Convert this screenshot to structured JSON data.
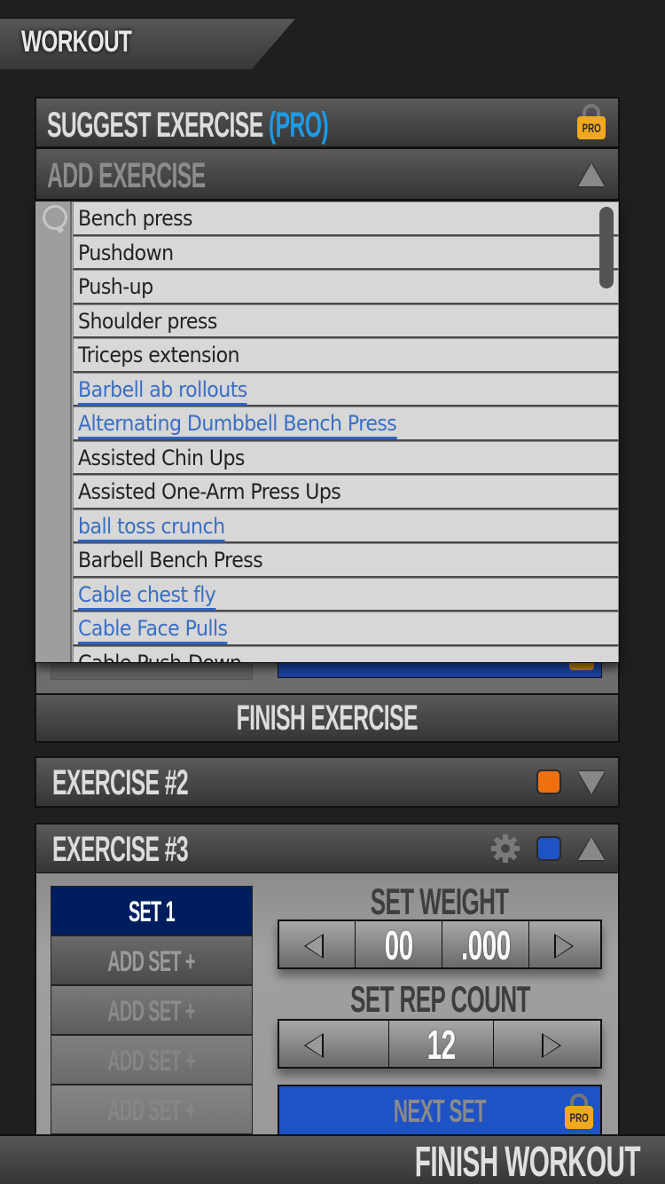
{
  "header": {
    "title": "WORKOUT"
  },
  "suggest": {
    "title": "SUGGEST EXERCISE",
    "pro_tag": "(PRO)",
    "lock_label": "PRO"
  },
  "add_exercise": {
    "title": "ADD EXERCISE",
    "expanded": true,
    "items": [
      {
        "label": "Bench press",
        "link": false
      },
      {
        "label": "Pushdown",
        "link": false
      },
      {
        "label": "Push-up",
        "link": false
      },
      {
        "label": "Shoulder press",
        "link": false
      },
      {
        "label": "Triceps extension",
        "link": false
      },
      {
        "label": "Barbell ab rollouts",
        "link": true
      },
      {
        "label": "Alternating Dumbbell Bench Press",
        "link": true
      },
      {
        "label": "Assisted Chin Ups",
        "link": false
      },
      {
        "label": "Assisted One-Arm Press Ups",
        "link": false
      },
      {
        "label": "ball toss crunch",
        "link": true
      },
      {
        "label": "Barbell Bench Press",
        "link": false
      },
      {
        "label": "Cable chest fly",
        "link": true
      },
      {
        "label": "Cable Face Pulls",
        "link": true
      },
      {
        "label": "Cable Push-Down",
        "link": false
      }
    ]
  },
  "finish_exercise": {
    "label": "FINISH EXERCISE"
  },
  "exercise2": {
    "title": "EXERCISE #2",
    "color": "#f07010",
    "expanded": false
  },
  "exercise3": {
    "title": "EXERCISE #3",
    "color": "#1f52c4",
    "expanded": true,
    "sets": [
      {
        "label": "SET 1",
        "active": true
      },
      {
        "label": "ADD SET +",
        "active": false
      },
      {
        "label": "ADD SET +",
        "active": false
      },
      {
        "label": "ADD SET +",
        "active": false
      },
      {
        "label": "ADD SET +",
        "active": false
      }
    ],
    "weight_label": "SET WEIGHT",
    "weight_whole": "00",
    "weight_fraction": ".000",
    "rep_label": "SET REP COUNT",
    "rep_count": "12",
    "next_set": "NEXT SET",
    "lock_label": "PRO"
  },
  "footer": {
    "finish_workout": "FINISH WORKOUT"
  },
  "colors": {
    "accent_blue": "#1c9be6",
    "lock_gold": "#f0a91e",
    "active_set": "#001e5e"
  }
}
